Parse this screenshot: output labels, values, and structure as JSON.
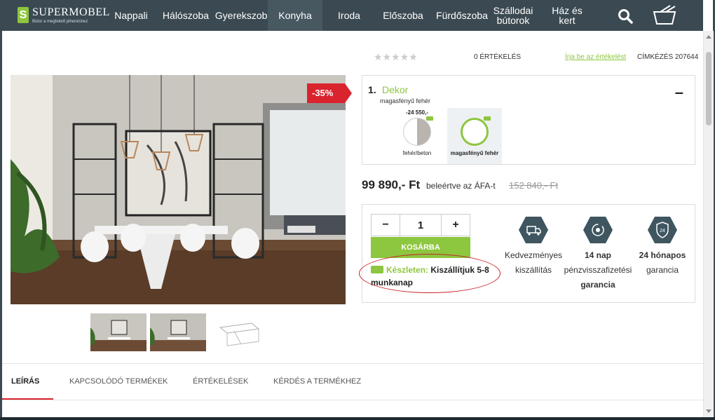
{
  "header": {
    "logo": {
      "name": "SUPERMOBEL",
      "tagline": "Bútor a megfelelő pihenéshez"
    },
    "nav": [
      {
        "label": "Nappali"
      },
      {
        "label": "Hálószoba"
      },
      {
        "label": "Gyerekszoba"
      },
      {
        "label": "Konyha",
        "active": true
      },
      {
        "label": "Iroda"
      },
      {
        "label": "Előszoba"
      },
      {
        "label": "Fürdőszoba"
      },
      {
        "label": "Szállodai bútorok"
      },
      {
        "label": "Ház és kert"
      }
    ],
    "icons": [
      "search-icon",
      "cart-basket-icon"
    ]
  },
  "product": {
    "rating_stars": "★★★★★",
    "rating_count": "0 ÉRTÉKELÉS",
    "write_review": "Írja be az értékelést",
    "sku": "CÍMKÉZÉS 207644",
    "discount": "-35%",
    "decor": {
      "number": "1.",
      "title": "Dekor",
      "selected_value": "magasfényű fehér",
      "swatches": [
        {
          "price": "-24 550,-",
          "label": "fehér/beton",
          "selected": false
        },
        {
          "price": "",
          "label": "magasfényű fehér",
          "selected": true
        }
      ]
    },
    "price": "99 890,- Ft",
    "price_note": "beleértve az ÁFA-t",
    "old_price": "152 840,- Ft",
    "quantity": "1",
    "qty_minus": "−",
    "qty_plus": "+",
    "cart_button": "KOSÁRBA",
    "stock_label": "Készleten:",
    "stock_text": "Kiszállítjuk 5-8 munkanap",
    "features": [
      {
        "icon": "truck-icon",
        "line1": "Kedvezményes",
        "line2": "kiszállítás",
        "line3": ""
      },
      {
        "icon": "money-back-icon",
        "line1": "14 nap",
        "line2": "pénzvisszafizetési",
        "line3": "garancia"
      },
      {
        "icon": "shield-24-icon",
        "line1": "24 hónapos",
        "line2": "garancia",
        "line3": ""
      }
    ]
  },
  "tabs": [
    {
      "label": "LEÍRÁS",
      "active": true
    },
    {
      "label": "KAPCSOLÓDÓ TERMÉKEK"
    },
    {
      "label": "ÉRTÉKELÉSEK"
    },
    {
      "label": "KÉRDÉS A TERMÉKHEZ"
    }
  ],
  "colors": {
    "header_bg": "#3b4a52",
    "accent_green": "#8dc63f",
    "discount_red": "#d9232d",
    "hex_icon": "#3f5661"
  }
}
